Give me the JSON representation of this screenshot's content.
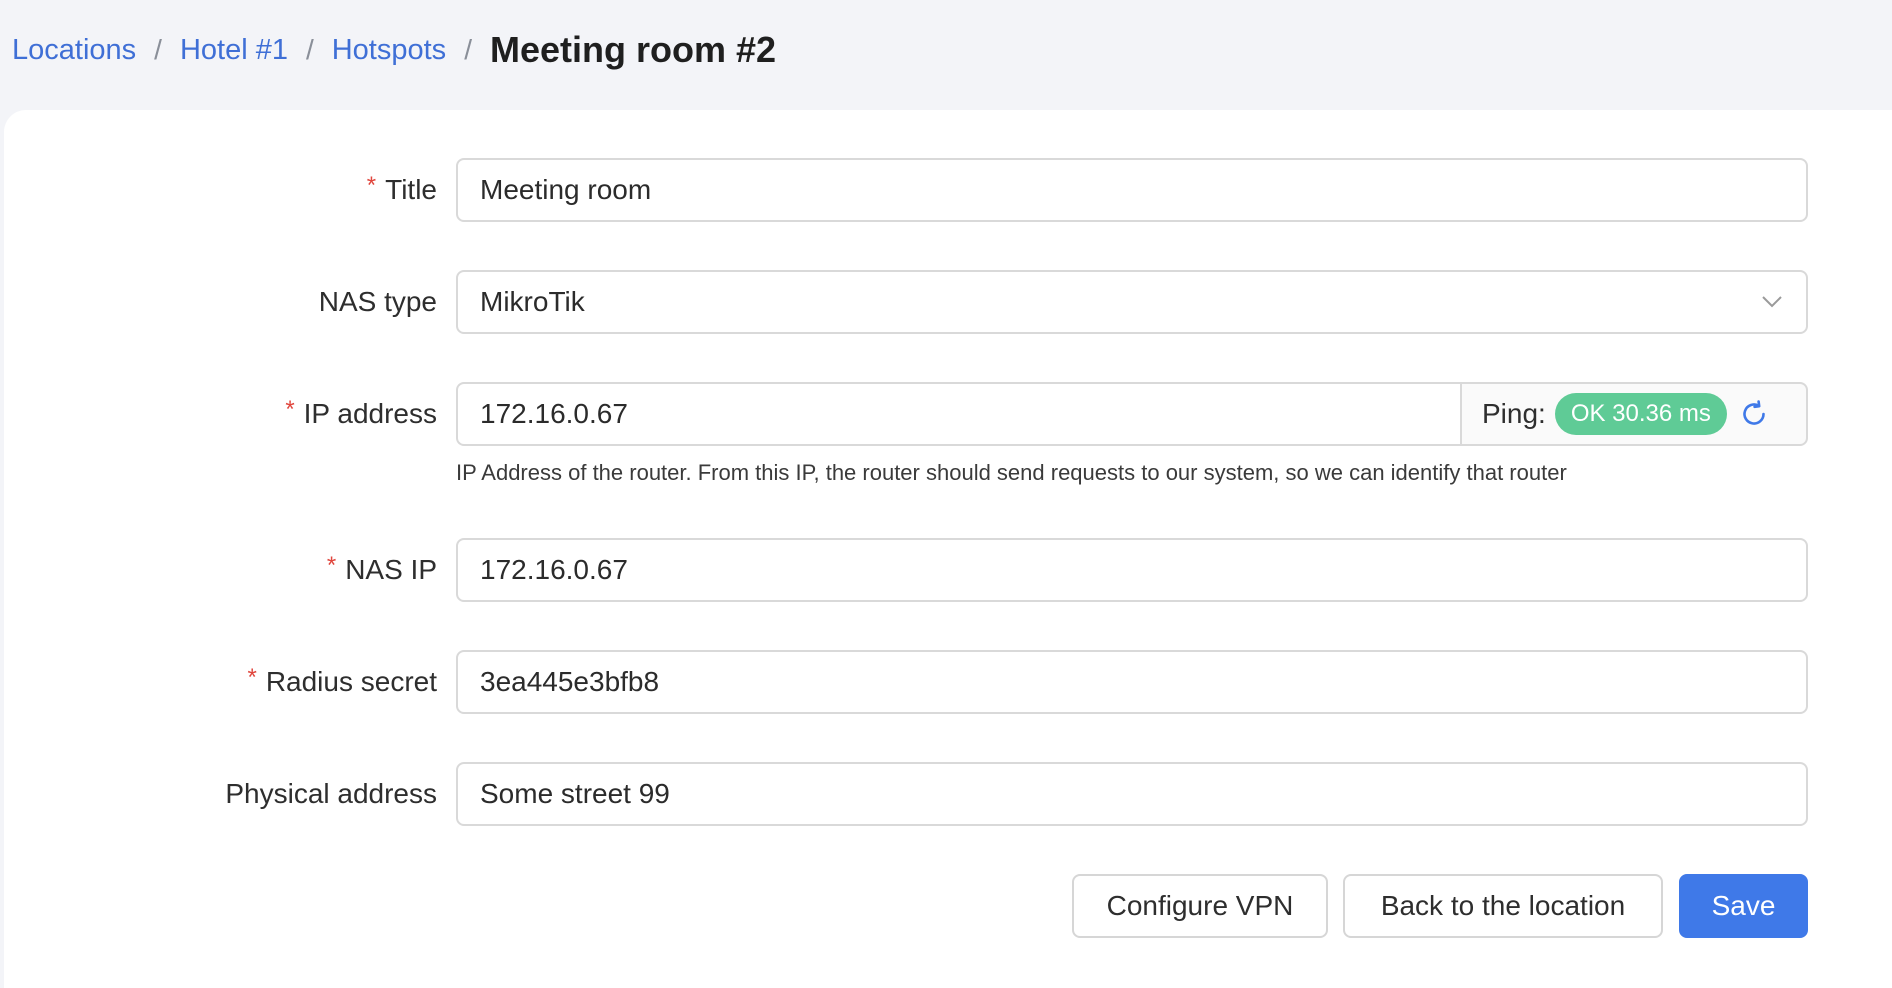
{
  "breadcrumb": {
    "items": [
      "Locations",
      "Hotel #1",
      "Hotspots"
    ],
    "separator": "/",
    "current": "Meeting room #2"
  },
  "form": {
    "title": {
      "label": "Title",
      "required": "*",
      "value": "Meeting room"
    },
    "nas_type": {
      "label": "NAS type",
      "value": "MikroTik",
      "icon": "chevron-down-icon"
    },
    "ip_address": {
      "label": "IP address",
      "required": "*",
      "value": "172.16.0.67",
      "ping_label": "Ping:",
      "ping_status": "OK 30.36 ms",
      "hint": "IP Address of the router. From this IP, the router should send requests to our system, so we can identify that router"
    },
    "nas_ip": {
      "label": "NAS IP",
      "required": "*",
      "value": "172.16.0.67"
    },
    "radius_secret": {
      "label": "Radius secret",
      "required": "*",
      "value": "3ea445e3bfb8"
    },
    "physical_address": {
      "label": "Physical address",
      "value": "Some street 99"
    }
  },
  "actions": {
    "configure_vpn": "Configure VPN",
    "back": "Back to the location",
    "save": "Save"
  },
  "colors": {
    "link": "#3f6fd6",
    "primary": "#3f79e8",
    "success": "#5fcb96",
    "required": "#e0463d"
  }
}
